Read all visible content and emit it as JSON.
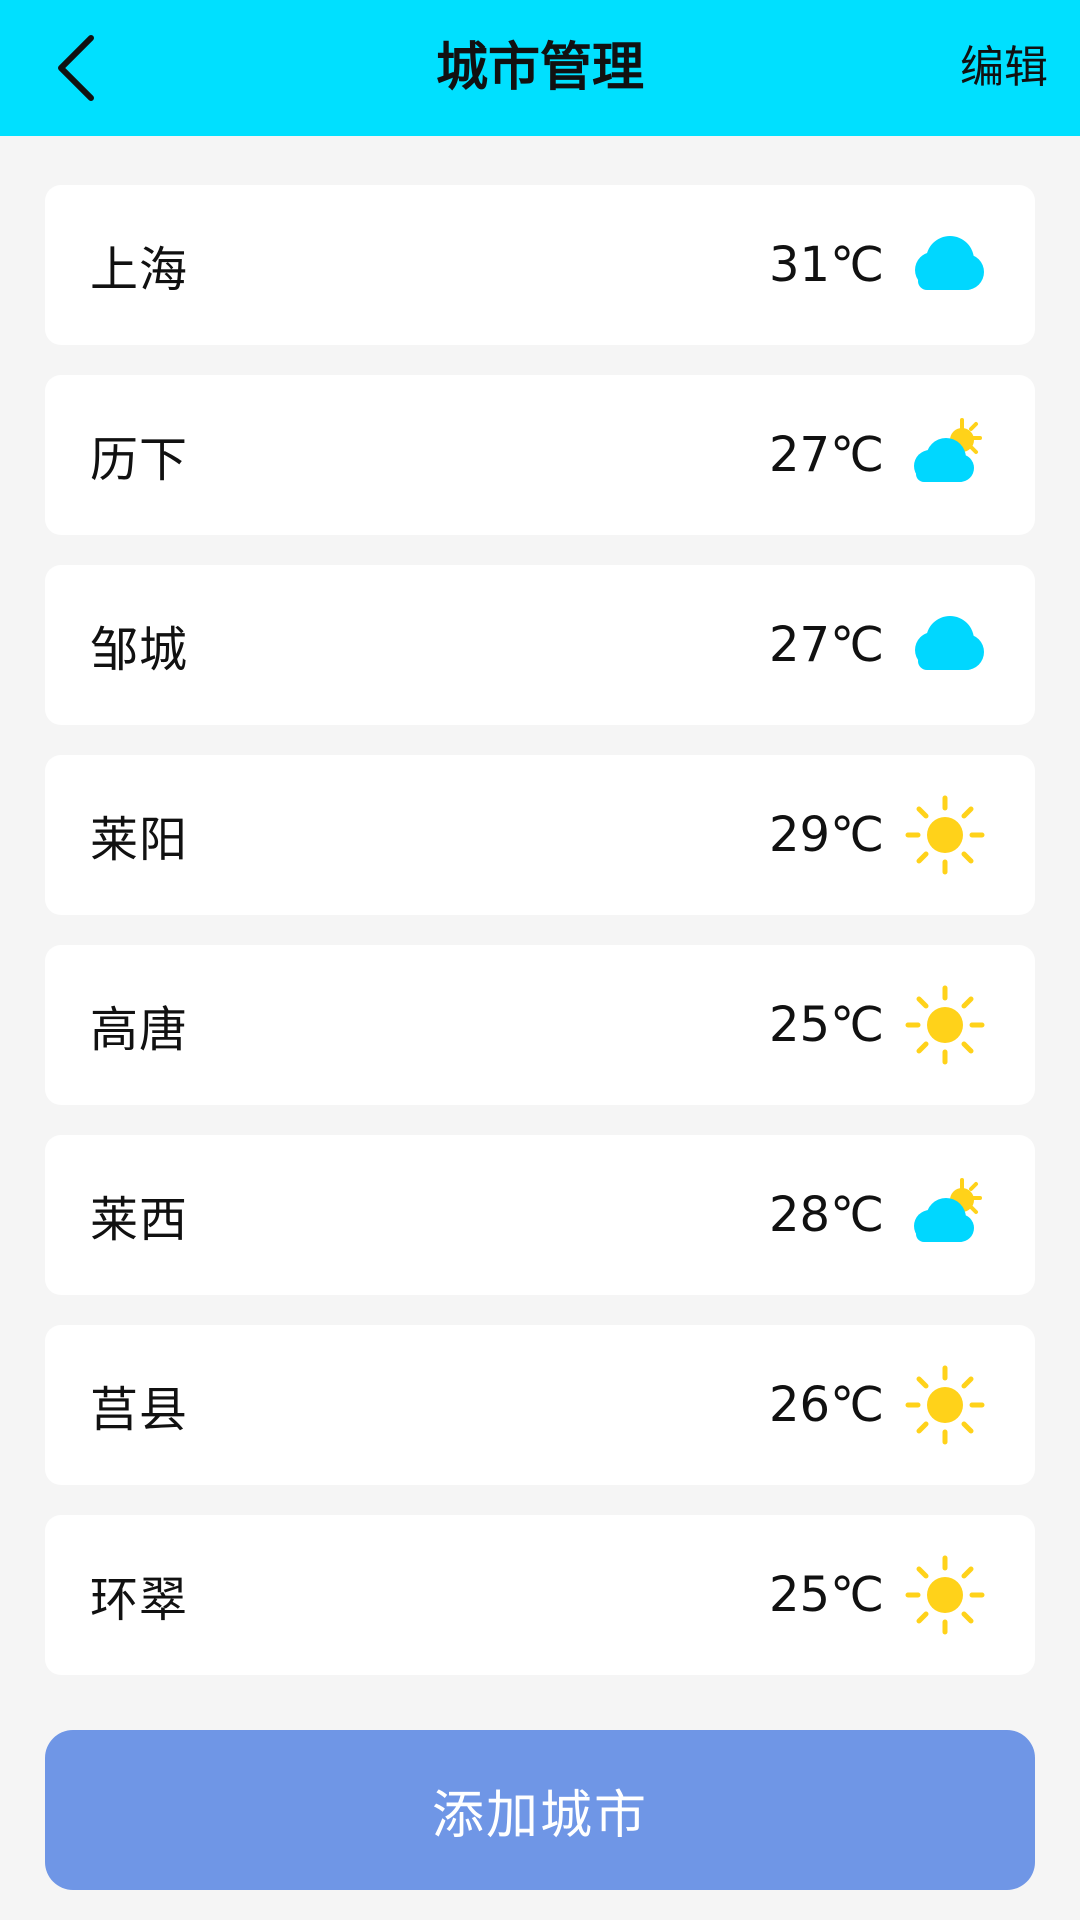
{
  "header": {
    "title": "城市管理",
    "edit_label": "编辑",
    "background": "#00e0ff"
  },
  "cities": [
    {
      "name": "上海",
      "temp": "31℃",
      "icon": "cloud-icon"
    },
    {
      "name": "历下",
      "temp": "27℃",
      "icon": "partly-cloudy-icon"
    },
    {
      "name": "邹城",
      "temp": "27℃",
      "icon": "cloud-icon"
    },
    {
      "name": "莱阳",
      "temp": "29℃",
      "icon": "sun-icon"
    },
    {
      "name": "高唐",
      "temp": "25℃",
      "icon": "sun-icon"
    },
    {
      "name": "莱西",
      "temp": "28℃",
      "icon": "partly-cloudy-icon"
    },
    {
      "name": "莒县",
      "temp": "26℃",
      "icon": "sun-icon"
    },
    {
      "name": "环翠",
      "temp": "25℃",
      "icon": "sun-icon"
    }
  ],
  "add_button": {
    "label": "添加城市",
    "color": "#6f96e6"
  },
  "colors": {
    "cloud": "#00d7ff",
    "sun": "#ffd21a"
  }
}
